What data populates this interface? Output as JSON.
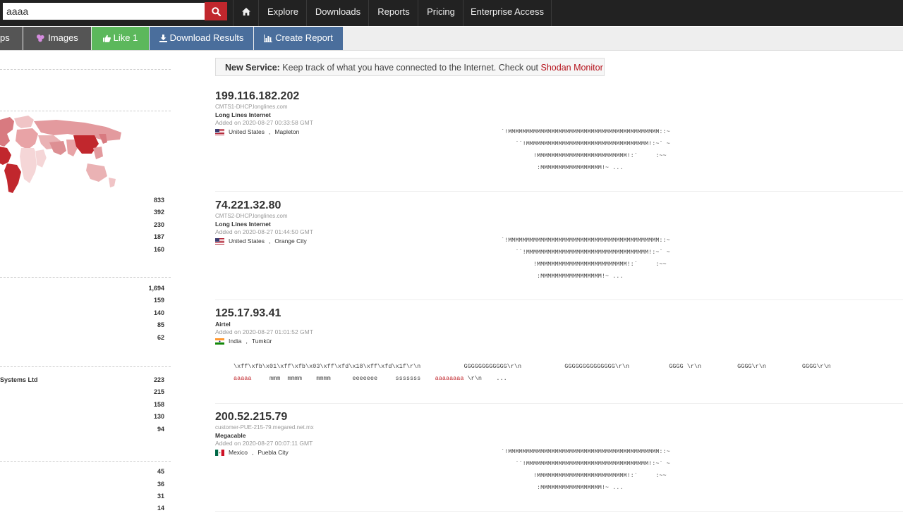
{
  "search": {
    "value": "aaaa"
  },
  "nav": {
    "explore": "Explore",
    "downloads": "Downloads",
    "reports": "Reports",
    "pricing": "Pricing",
    "enterprise": "Enterprise Access"
  },
  "subnav": {
    "maps": "ps",
    "images": "Images",
    "like": "Like 1",
    "download": "Download Results",
    "create_report": "Create Report"
  },
  "colors": {
    "topbar": "#222222",
    "search_button": "#c1272d",
    "like_button": "#5cb85c",
    "blue_button": "#4a6e9c",
    "map_dark": "#c1272d"
  },
  "notice": {
    "label": "New Service:",
    "text": " Keep track of what you have connected to the Internet. Check out ",
    "link": "Shodan Monitor"
  },
  "facets": {
    "countries": [
      "833",
      "392",
      "230",
      "187",
      "160"
    ],
    "group2": [
      "1,694",
      "159",
      "140",
      "85",
      "62"
    ],
    "group3_first_label": "Systems Ltd",
    "group3": [
      "223",
      "215",
      "158",
      "130",
      "94"
    ],
    "group4": [
      "45",
      "36",
      "31",
      "14"
    ]
  },
  "results": [
    {
      "ip": "199.116.182.202",
      "hostname": "CMTS1-DHCP.longlines.com",
      "org": "Long Lines Internet",
      "added": "Added on 2020-08-27 00:33:58 GMT",
      "country": "United States",
      "city": "Mapleton",
      "flag": "us",
      "banner": [
        "`!MMMMMMMMMMMMMMMMMMMMMMMMMMMMMMMMMMMMMMMMMM::~",
        "    ``!MMMMMMMMMMMMMMMMMMMMMMMMMMMMMMMMMM!:~` ~",
        "         !MMMMMMMMMMMMMMMMMMMMMMMMM!:`     :~~",
        "          :MMMMMMMMMMMMMMMMM!~ ..."
      ]
    },
    {
      "ip": "74.221.32.80",
      "hostname": "CMTS2-DHCP.longlines.com",
      "org": "Long Lines Internet",
      "added": "Added on 2020-08-27 01:44:50 GMT",
      "country": "United States",
      "city": "Orange City",
      "flag": "us",
      "banner": [
        "`!MMMMMMMMMMMMMMMMMMMMMMMMMMMMMMMMMMMMMMMMMM::~",
        "    ``!MMMMMMMMMMMMMMMMMMMMMMMMMMMMMMMMMM!:~` ~",
        "         !MMMMMMMMMMMMMMMMMMMMMMMMM!:`     :~~",
        "          :MMMMMMMMMMMMMMMMM!~ ..."
      ]
    },
    {
      "ip": "125.17.93.41",
      "hostname": "",
      "org": "Airtel",
      "added": "Added on 2020-08-27 01:01:52 GMT",
      "country": "India",
      "city": "Tumkūr",
      "flag": "in",
      "banner_line1": "\\xff\\xfb\\x01\\xff\\xfb\\x03\\xff\\xfd\\x18\\xff\\xfd\\x1f\\r\\n            GGGGGGGGGGGG\\r\\n            GGGGGGGGGGGGGG\\r\\n           GGGG \\r\\n          GGGG\\r\\n          GGGG\\r\\n",
      "banner_hl1": "aaaaa",
      "banner_mid": "     mmm  mmmm    mmmm      eeeeeee     sssssss    ",
      "banner_hl2": "aaaaaaaa",
      "banner_end": " \\r\\n    ..."
    },
    {
      "ip": "200.52.215.79",
      "hostname": "customer-PUE-215-79.megared.net.mx",
      "org": "Megacable",
      "added": "Added on 2020-08-27 00:07:11 GMT",
      "country": "Mexico",
      "city": "Puebla City",
      "flag": "mx",
      "banner": [
        "`!MMMMMMMMMMMMMMMMMMMMMMMMMMMMMMMMMMMMMMMMMM::~",
        "    ``!MMMMMMMMMMMMMMMMMMMMMMMMMMMMMMMMMM!:~` ~",
        "         !MMMMMMMMMMMMMMMMMMMMMMMMM!:`     :~~",
        "          :MMMMMMMMMMMMMMMMM!~ ..."
      ]
    }
  ]
}
